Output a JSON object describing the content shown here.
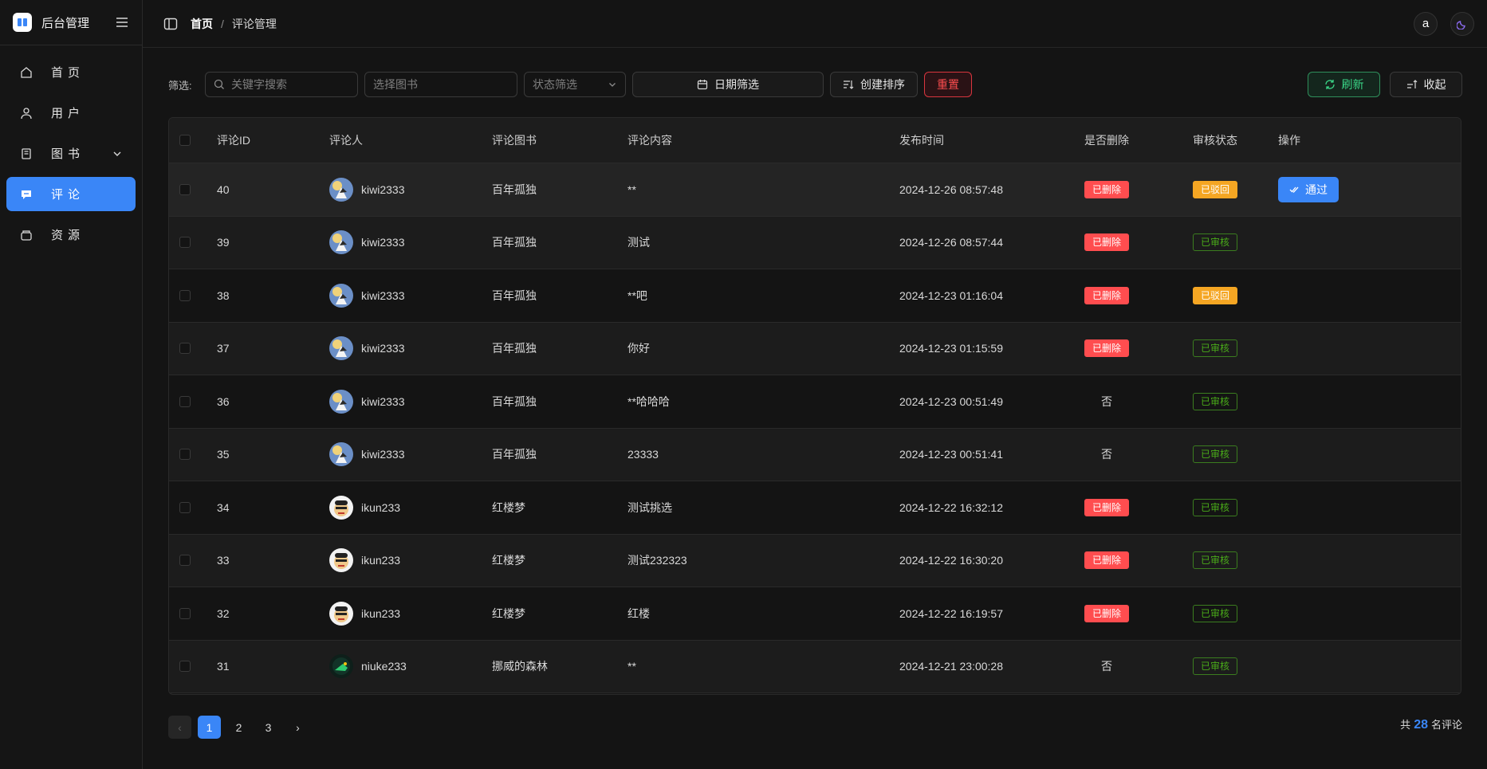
{
  "brand": {
    "title": "后台管理"
  },
  "sidebar": {
    "items": [
      {
        "label": "首页",
        "icon": "home-icon"
      },
      {
        "label": "用户",
        "icon": "user-icon"
      },
      {
        "label": "图书",
        "icon": "book-icon"
      },
      {
        "label": "评论",
        "icon": "comment-icon",
        "active": true
      },
      {
        "label": "资源",
        "icon": "resource-icon"
      }
    ]
  },
  "header": {
    "breadcrumb": {
      "home": "首页",
      "separator": "/",
      "current": "评论管理"
    },
    "user_initial": "a"
  },
  "toolbar": {
    "filter_label": "筛选:",
    "keyword_placeholder": "关键字搜索",
    "book_placeholder": "选择图书",
    "status_placeholder": "状态筛选",
    "date_label": "日期筛选",
    "sort_label": "创建排序",
    "reset_label": "重置",
    "refresh_label": "刷新",
    "collapse_label": "收起"
  },
  "table": {
    "columns": [
      "评论ID",
      "评论人",
      "评论图书",
      "评论内容",
      "发布时间",
      "是否删除",
      "审核状态",
      "操作"
    ],
    "rows": [
      {
        "id": "40",
        "user": "kiwi2333",
        "book": "百年孤独",
        "content": "**",
        "time": "2024-12-26 08:57:48",
        "deleted": "已删除",
        "status": "已驳回",
        "action": "通过"
      },
      {
        "id": "39",
        "user": "kiwi2333",
        "book": "百年孤独",
        "content": "测试",
        "time": "2024-12-26 08:57:44",
        "deleted": "已删除",
        "status": "已审核",
        "action": ""
      },
      {
        "id": "38",
        "user": "kiwi2333",
        "book": "百年孤独",
        "content": "**吧",
        "time": "2024-12-23 01:16:04",
        "deleted": "已删除",
        "status": "已驳回",
        "action": ""
      },
      {
        "id": "37",
        "user": "kiwi2333",
        "book": "百年孤独",
        "content": "你好",
        "time": "2024-12-23 01:15:59",
        "deleted": "已删除",
        "status": "已审核",
        "action": ""
      },
      {
        "id": "36",
        "user": "kiwi2333",
        "book": "百年孤独",
        "content": "**哈哈哈",
        "time": "2024-12-23 00:51:49",
        "deleted": "否",
        "status": "已审核",
        "action": ""
      },
      {
        "id": "35",
        "user": "kiwi2333",
        "book": "百年孤独",
        "content": "23333",
        "time": "2024-12-23 00:51:41",
        "deleted": "否",
        "status": "已审核",
        "action": ""
      },
      {
        "id": "34",
        "user": "ikun233",
        "book": "红楼梦",
        "content": "测试挑选",
        "time": "2024-12-22 16:32:12",
        "deleted": "已删除",
        "status": "已审核",
        "action": ""
      },
      {
        "id": "33",
        "user": "ikun233",
        "book": "红楼梦",
        "content": "测试232323",
        "time": "2024-12-22 16:30:20",
        "deleted": "已删除",
        "status": "已审核",
        "action": ""
      },
      {
        "id": "32",
        "user": "ikun233",
        "book": "红楼梦",
        "content": "红楼",
        "time": "2024-12-22 16:19:57",
        "deleted": "已删除",
        "status": "已审核",
        "action": ""
      },
      {
        "id": "31",
        "user": "niuke233",
        "book": "挪威的森林",
        "content": "**",
        "time": "2024-12-21 23:00:28",
        "deleted": "否",
        "status": "已审核",
        "action": ""
      }
    ]
  },
  "pagination": {
    "pages": [
      "1",
      "2",
      "3"
    ],
    "current": "1",
    "prev": "‹",
    "next": "›",
    "total_prefix": "共",
    "total_count": "28",
    "total_suffix": "名评论"
  },
  "colors": {
    "accent": "#3a86f7",
    "danger": "#ff4d4f",
    "warning": "#f5a623",
    "success": "#49aa19",
    "refresh": "#3ad687"
  }
}
